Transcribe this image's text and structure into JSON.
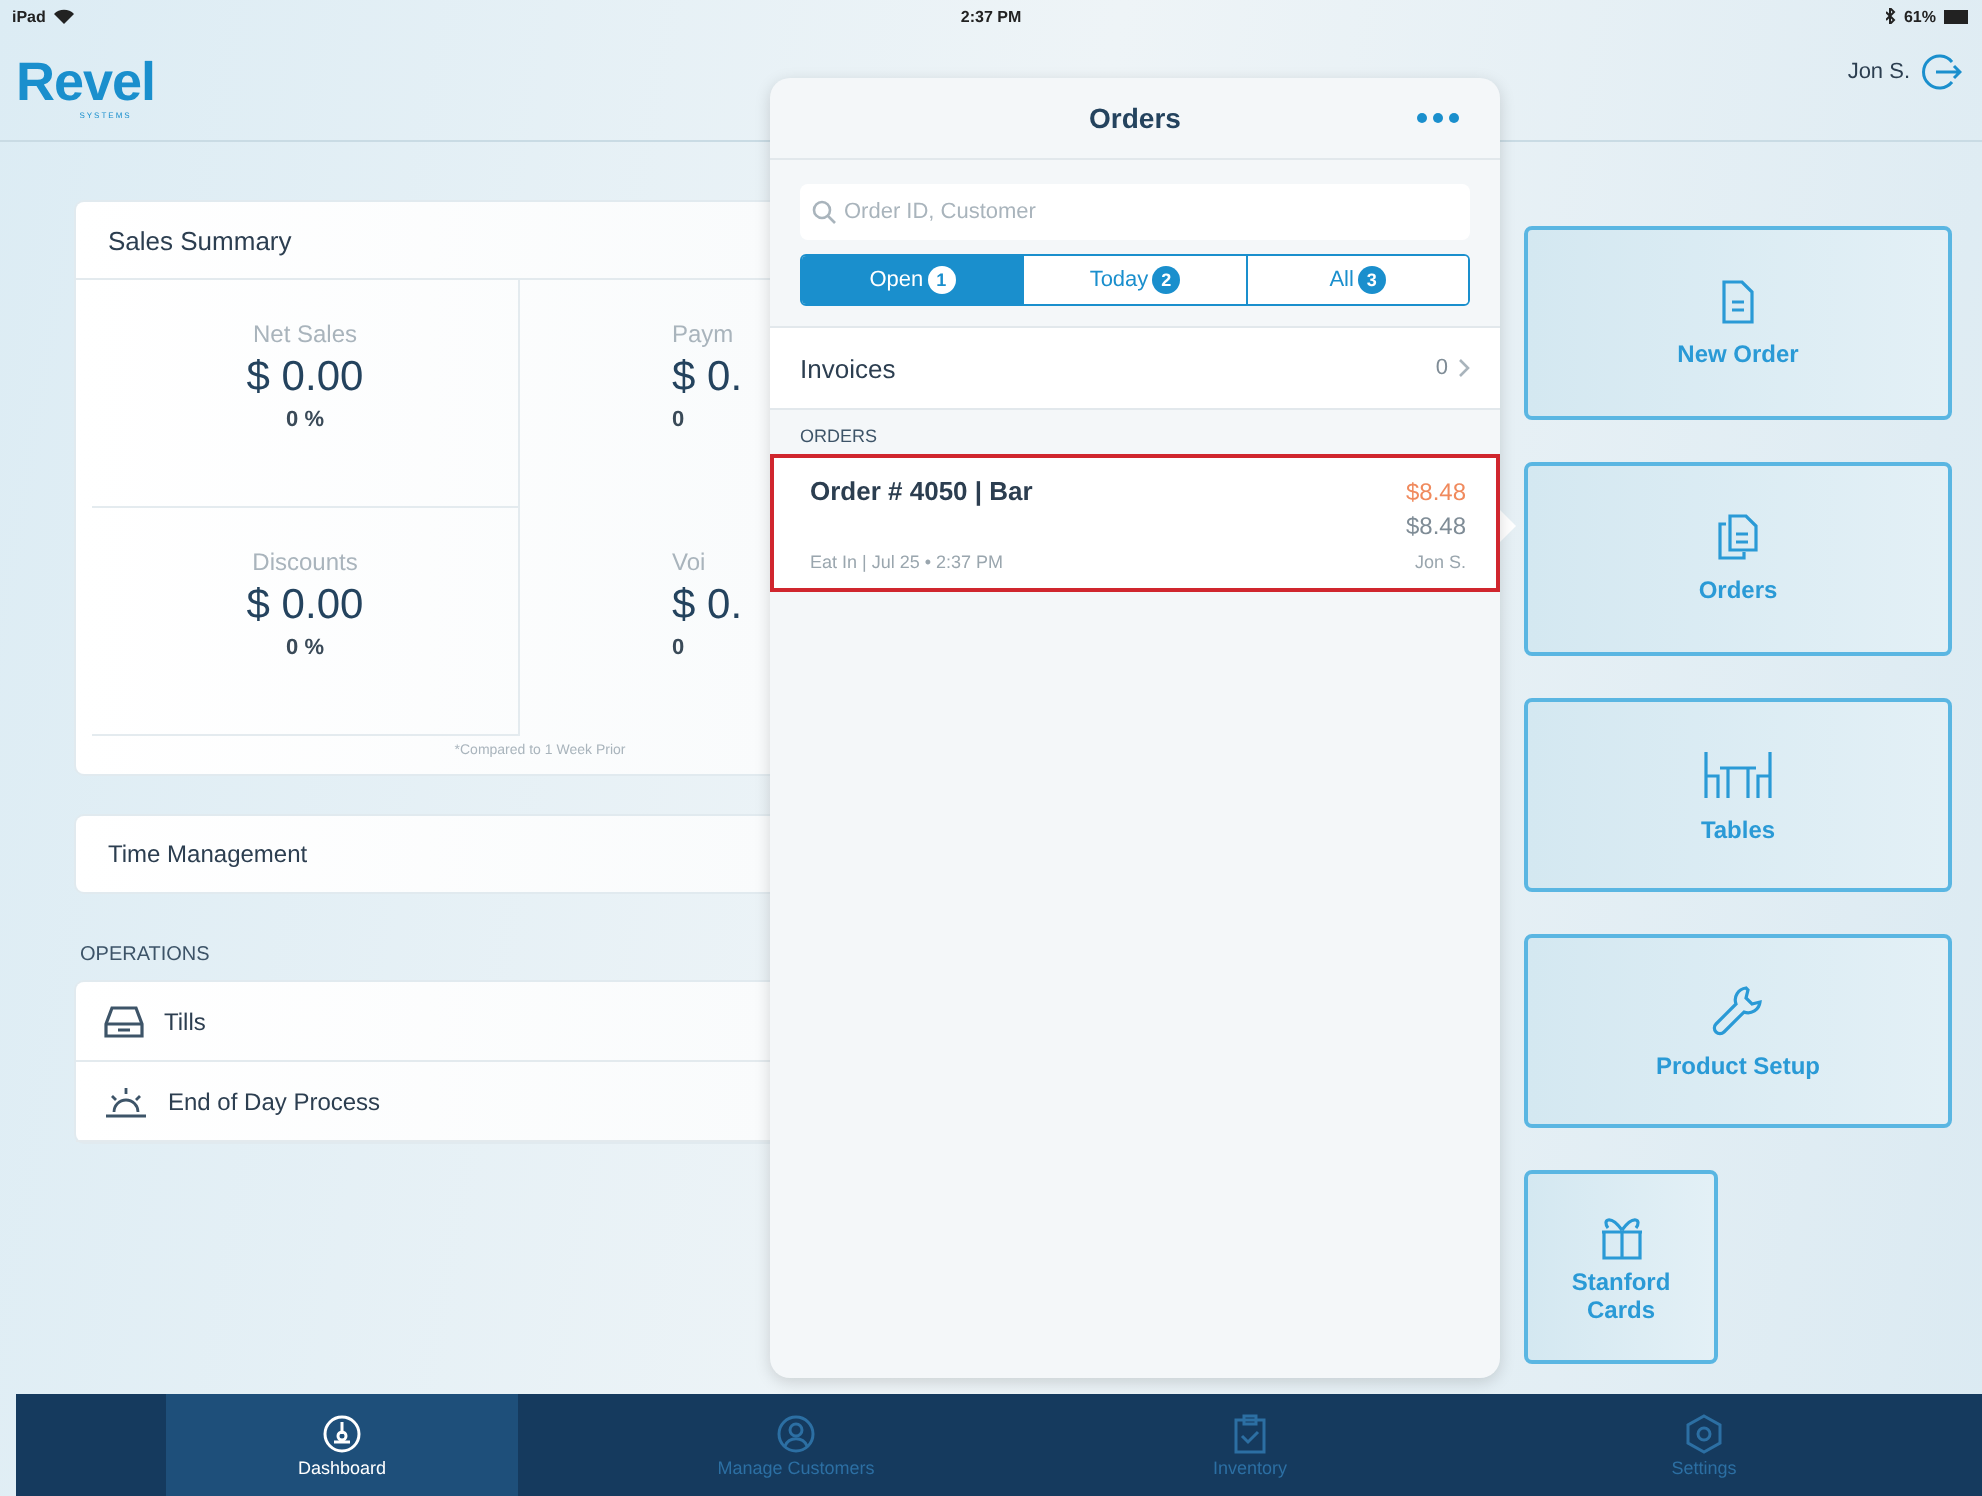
{
  "status_bar": {
    "device": "iPad",
    "time": "2:37 PM",
    "battery": "61%"
  },
  "header": {
    "logo": "Revel",
    "logo_sub": "SYSTEMS",
    "user": "Jon S."
  },
  "sales_summary": {
    "title": "Sales Summary",
    "metrics": [
      {
        "label": "Net Sales",
        "value": "$ 0.00",
        "change": "0 %"
      },
      {
        "label": "Paym",
        "value": "$ 0.",
        "change": "0"
      },
      {
        "label": "Discounts",
        "value": "$ 0.00",
        "change": "0 %"
      },
      {
        "label": "Voi",
        "value": "$ 0.",
        "change": "0"
      }
    ],
    "footnote": "*Compared to 1 Week Prior"
  },
  "time_management": {
    "title": "Time Management"
  },
  "operations": {
    "heading": "OPERATIONS",
    "items": [
      {
        "label": "Tills",
        "kind": "till"
      },
      {
        "label": "End of Day Process",
        "kind": "sunset"
      }
    ]
  },
  "orders_popover": {
    "title": "Orders",
    "search": {
      "placeholder": "Order ID, Customer"
    },
    "filters": [
      {
        "label": "Open",
        "count": "1",
        "selected": true
      },
      {
        "label": "Today",
        "count": "2",
        "selected": false
      },
      {
        "label": "All",
        "count": "3",
        "selected": false
      }
    ],
    "invoices": {
      "label": "Invoices",
      "count": "0"
    },
    "section": "ORDERS",
    "orders": [
      {
        "title": "Order # 4050 | Bar",
        "total": "$8.48",
        "balance": "$8.48",
        "details": "Eat In | Jul 25 • 2:37 PM",
        "employee": "Jon S.",
        "highlighted": true
      }
    ]
  },
  "tiles": [
    {
      "label": "New Order",
      "kind": "new-order"
    },
    {
      "label": "Orders",
      "kind": "orders"
    },
    {
      "label": "Tables",
      "kind": "tables"
    },
    {
      "label": "Product Setup",
      "kind": "wrench"
    },
    {
      "label": "Stanford Cards",
      "kind": "gift"
    }
  ],
  "tab_bar": [
    {
      "label": "Dashboard",
      "kind": "dashboard",
      "selected": true
    },
    {
      "label": "Manage Customers",
      "kind": "customer",
      "selected": false
    },
    {
      "label": "Inventory",
      "kind": "clipboard",
      "selected": false
    },
    {
      "label": "Settings",
      "kind": "settings",
      "selected": false
    }
  ]
}
